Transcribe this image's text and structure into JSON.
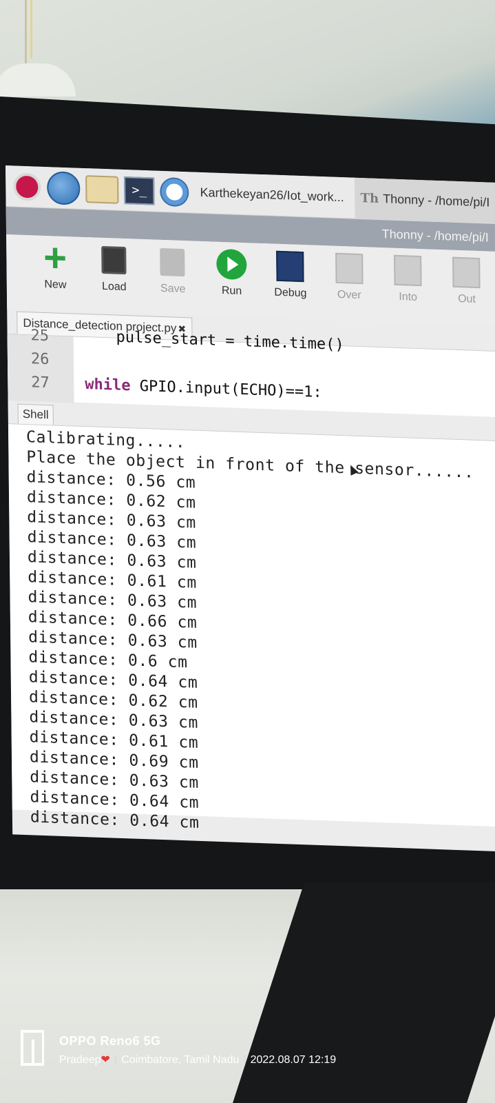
{
  "taskbar": {
    "browser_tab": "Karthekeyan26/Iot_work...",
    "thonny_tab": "Thonny  -  /home/pi/I"
  },
  "titlebar": {
    "title": "Thonny  -  /home/pi/I"
  },
  "toolbar": {
    "new": "New",
    "load": "Load",
    "save": "Save",
    "run": "Run",
    "debug": "Debug",
    "over": "Over",
    "into": "Into",
    "out": "Out"
  },
  "editor": {
    "tab_label": "Distance_detection project.py",
    "tab_close": "✖",
    "lines": [
      {
        "number": "25",
        "code": "pulse_start = time.time()"
      },
      {
        "number": "26",
        "code": ""
      },
      {
        "number": "27",
        "code_keyword": "while",
        "code_rest": " GPIO.input(ECHO)==1:"
      }
    ]
  },
  "shell": {
    "tab_label": "Shell",
    "lines": [
      "Calibrating.....",
      "Place the object in front of the sensor......",
      "distance: 0.56 cm",
      "distance: 0.62 cm",
      "distance: 0.63 cm",
      "distance: 0.63 cm",
      "distance: 0.63 cm",
      "distance: 0.61 cm",
      "distance: 0.63 cm",
      "distance: 0.66 cm",
      "distance: 0.63 cm",
      "distance: 0.6 cm",
      "distance: 0.64 cm",
      "distance: 0.62 cm",
      "distance: 0.63 cm",
      "distance: 0.61 cm",
      "distance: 0.69 cm",
      "distance: 0.63 cm",
      "distance: 0.64 cm",
      "distance: 0.64 cm"
    ]
  },
  "watermark": {
    "device": "OPPO Reno6 5G",
    "user": "Pradeep",
    "location": "Coimbatore, Tamil Nadu",
    "datetime": "2022.08.07 12:19"
  }
}
